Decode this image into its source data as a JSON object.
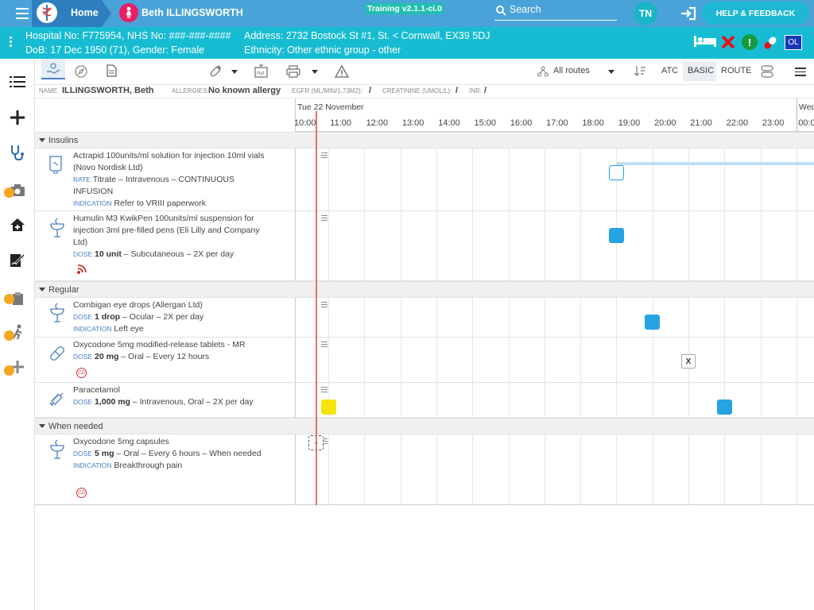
{
  "header": {
    "home_label": "Home",
    "patient_name": "Beth ILLINGSWORTH",
    "training": "Training v2.1.1-ci.0",
    "search_label": "Search",
    "initials": "TN",
    "help_label": "HELP & FEEDBACK"
  },
  "patient": {
    "ids": "Hospital No: F775954, NHS No: ###-###-####",
    "dob": "DoB: 17 Dec 1950 (71), Gender: Female",
    "address": "Address: 2732 Bostock St #1, St. < Cornwall, EX39 5DJ",
    "ethnicity": "Ethnicity: Other ethnic group - other",
    "ol_badge": "OL"
  },
  "toolbar": {
    "routes": "All routes",
    "atc": "ATC",
    "basic": "BASIC",
    "route": "ROUTE"
  },
  "info": {
    "name_label": "NAME",
    "name": "ILLINGSWORTH, Beth",
    "allergies_label": "ALLERGIES:",
    "allergies": "No known allergy",
    "egfr_label": "EGFR (ML/MIN/1.73M2):",
    "egfr": "/",
    "creat_label": "CREATININE (UMOL/L):",
    "creat": "/",
    "inr_label": "INR:",
    "inr": "/"
  },
  "timeline": {
    "date": "Tue 22 November",
    "hours": [
      "10:00",
      "11:00",
      "12:00",
      "13:00",
      "14:00",
      "15:00",
      "16:00",
      "17:00",
      "18:00",
      "19:00",
      "20:00",
      "21:00",
      "22:00",
      "23:00",
      "00:0"
    ],
    "next_day": "Wed"
  },
  "sections": {
    "insulins": "Insulins",
    "regular": "Regular",
    "prn": "When needed"
  },
  "meds": [
    {
      "name": "Actrapid 100units/ml solution for injection 10ml vials (Novo Nordisk Ltd)",
      "l1": "RATE",
      "t1": "Titrate – Intravenous – CONTINUOUS INFUSION",
      "l2": "INDICATION",
      "t2": "Refer to VRIII paperwork"
    },
    {
      "name": "Humulin M3 KwikPen 100units/ml suspension for injection 3ml pre-filled pens (Eli Lilly and Company Ltd)",
      "l1": "DOSE",
      "d1": "10 unit",
      "t1": " – Subcutaneous – 2X per day"
    },
    {
      "name": "Combigan eye drops (Allergan Ltd)",
      "l1": "DOSE",
      "d1": "1 drop",
      "t1": " – Ocular – 2X per day",
      "l2": "INDICATION",
      "t2": "Left eye"
    },
    {
      "name": "Oxycodone 5mg modified-release tablets - MR",
      "l1": "DOSE",
      "d1": "20 mg",
      "t1": " – Oral – Every 12 hours",
      "cd": "CD"
    },
    {
      "name": "Paracetamol",
      "l1": "DOSE",
      "d1": "1,000 mg",
      "t1": " – Intravenous, Oral – 2X per day"
    },
    {
      "name": "Oxycodone 5mg capsules",
      "l1": "DOSE",
      "d1": "5 mg",
      "t1": " – Oral – Every 6 hours – When needed",
      "l2": "INDICATION",
      "t2": "Breakthrough pain",
      "cd": "CD"
    }
  ],
  "marks": {
    "x": "X",
    "plus": "+"
  },
  "colors": {
    "header": "#4aa3d8",
    "patient_bar": "#17bcd2",
    "dose_blue": "#26a3e2",
    "dose_yellow": "#f5e50a",
    "now_line": "#e8735a"
  }
}
